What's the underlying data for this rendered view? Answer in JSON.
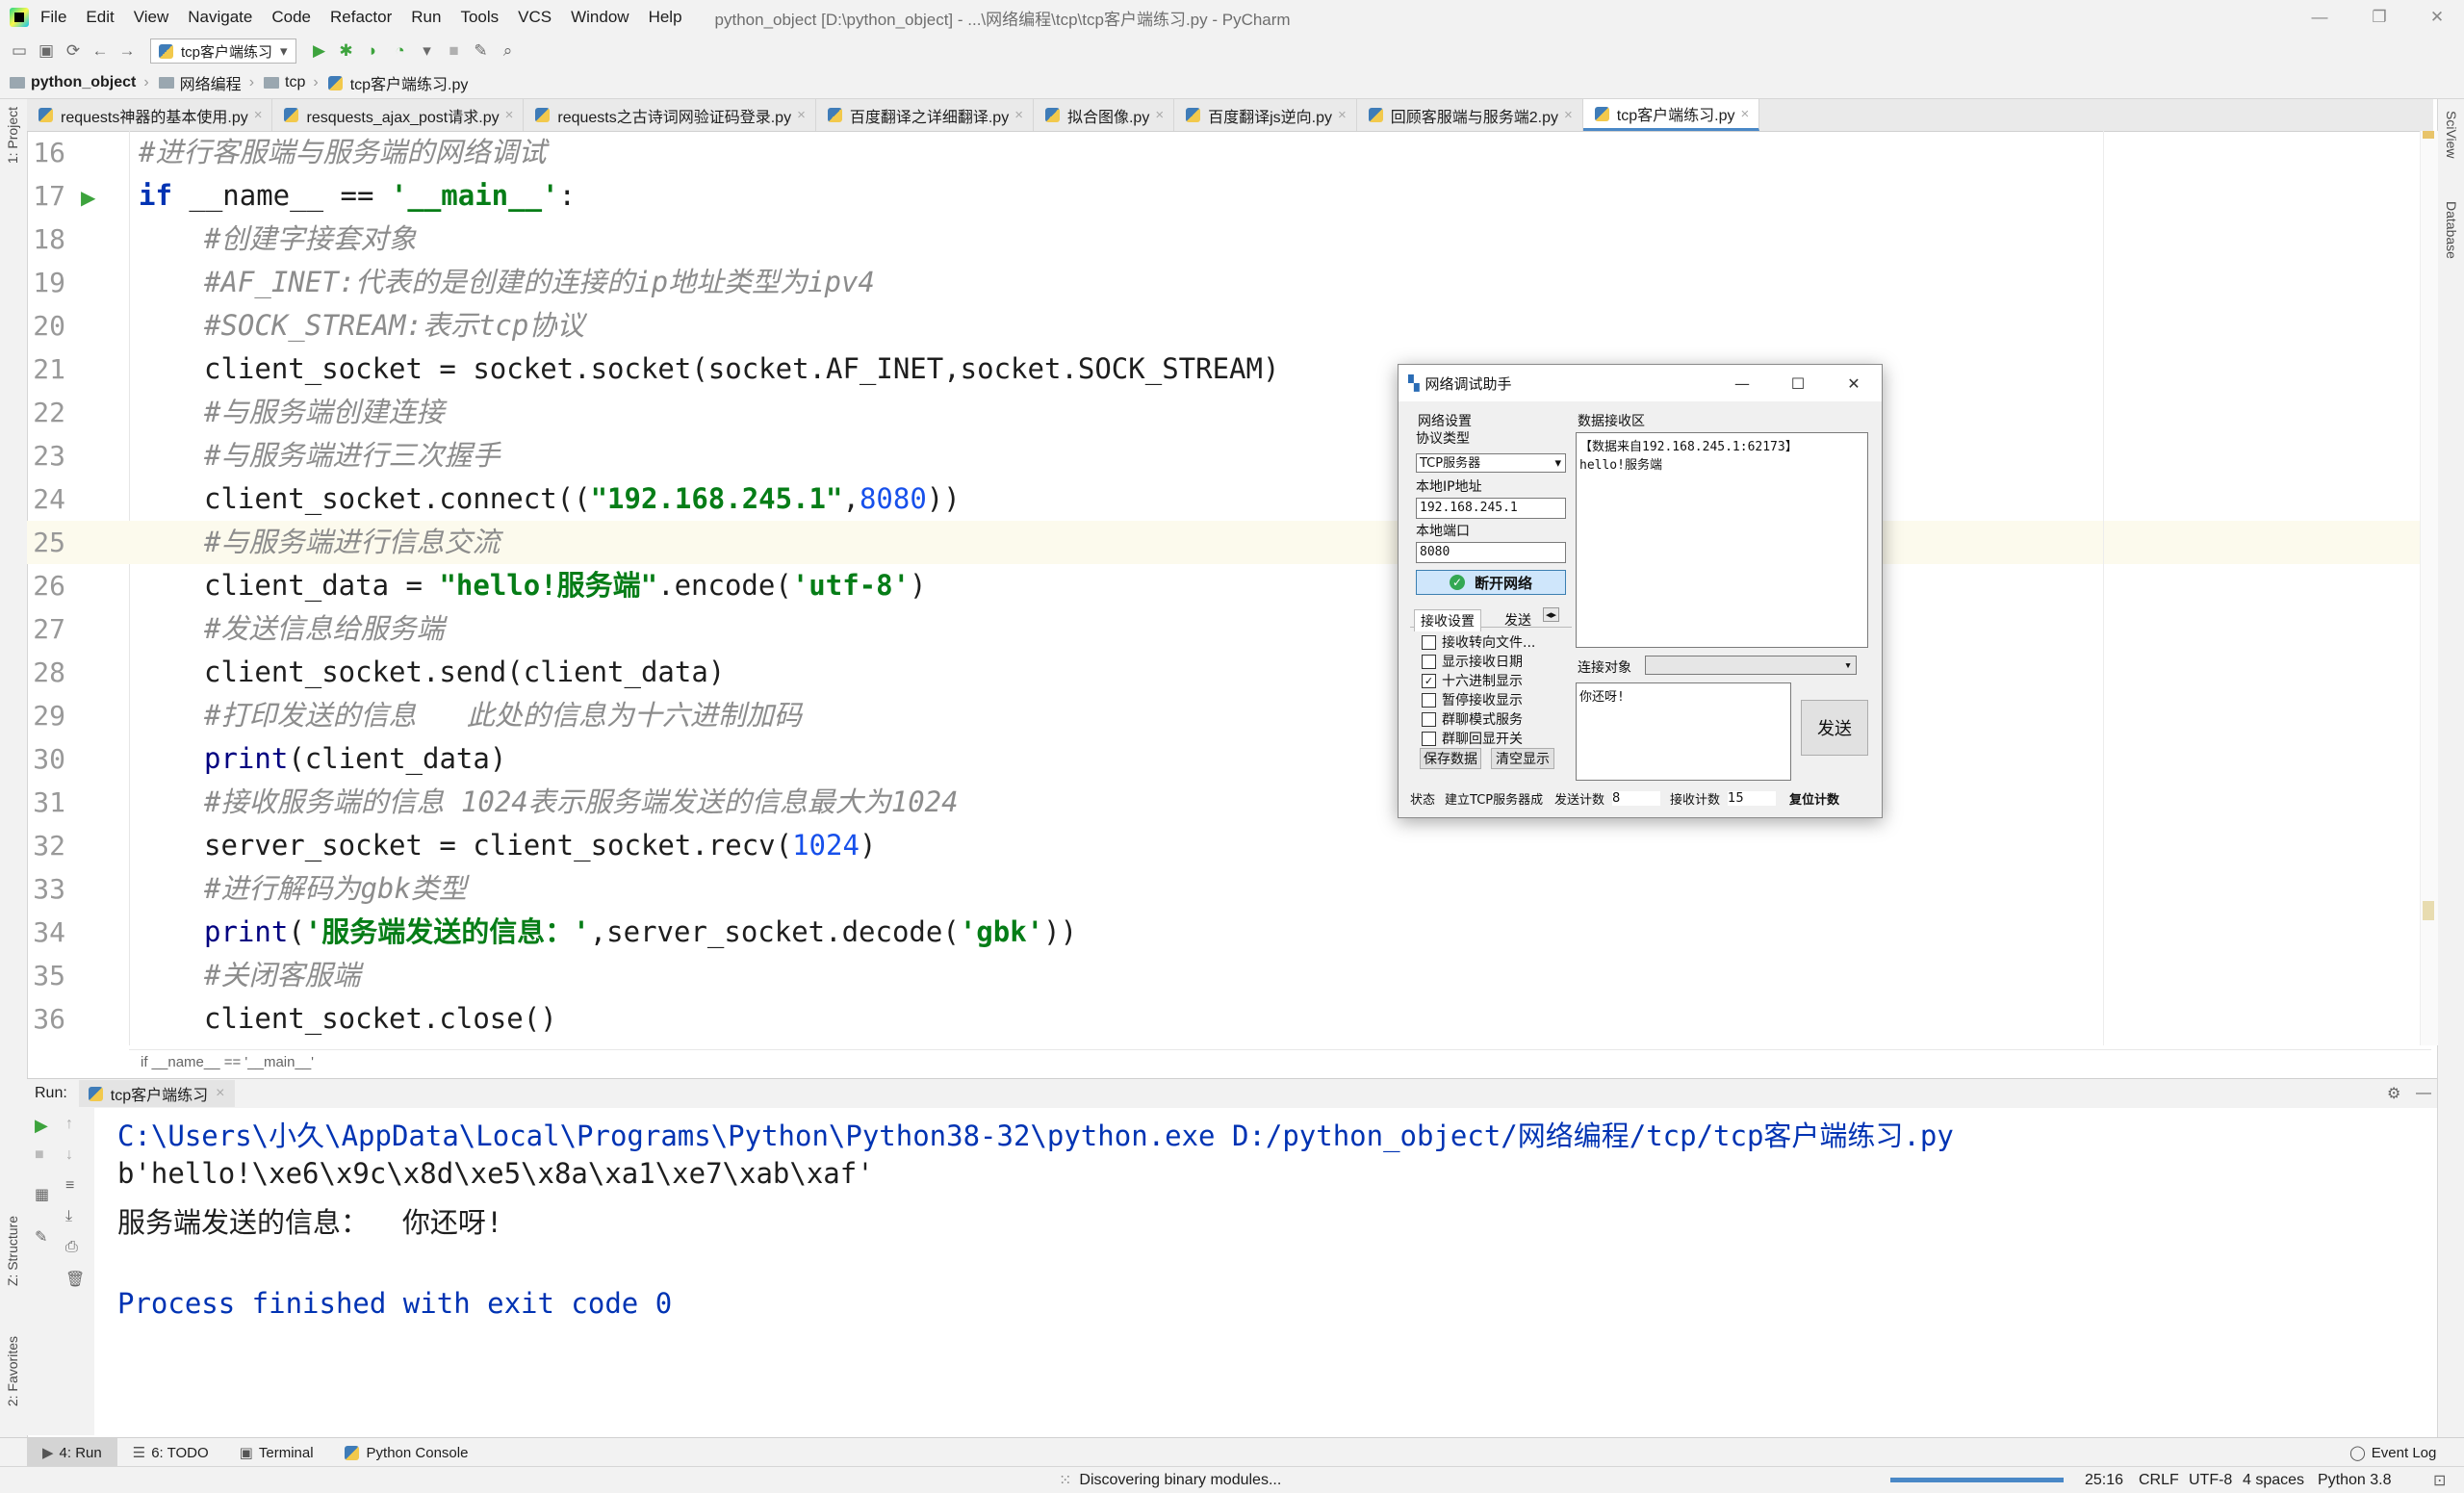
{
  "menubar": {
    "items": [
      "File",
      "Edit",
      "View",
      "Navigate",
      "Code",
      "Refactor",
      "Run",
      "Tools",
      "VCS",
      "Window",
      "Help"
    ],
    "title": "python_object [D:\\python_object] - ...\\网络编程\\tcp\\tcp客户端练习.py - PyCharm"
  },
  "toolbar": {
    "run_config": "tcp客户端练习"
  },
  "navbar": {
    "crumbs": [
      "python_object",
      "网络编程",
      "tcp",
      "tcp客户端练习.py"
    ]
  },
  "tabs": [
    "requests神器的基本使用.py",
    "resquests_ajax_post请求.py",
    "requests之古诗词网验证码登录.py",
    "百度翻译之详细翻译.py",
    "拟合图像.py",
    "百度翻译js逆向.py",
    "回顾客服端与服务端2.py",
    "tcp客户端练习.py"
  ],
  "sidebars": {
    "left_top": "1: Project",
    "left_structure": "Z: Structure",
    "left_favorites": "2: Favorites",
    "right_sciview": "SciView",
    "right_database": "Database"
  },
  "code": {
    "line_numbers": [
      "16",
      "17",
      "18",
      "19",
      "20",
      "21",
      "22",
      "23",
      "24",
      "25",
      "26",
      "27",
      "28",
      "29",
      "30",
      "31",
      "32",
      "33",
      "34",
      "35",
      "36"
    ],
    "l16": "#进行客服端与服务端的网络调试",
    "l17_kw": "if",
    "l17_a": " __name__ == ",
    "l17_s": "'__main__'",
    "l17_b": ":",
    "l18": "#创建字接套对象",
    "l19": "#AF_INET:代表的是创建的连接的ip地址类型为ipv4",
    "l20": "#SOCK_STREAM:表示tcp协议",
    "l21": "client_socket = socket.socket(socket.AF_INET,socket.SOCK_STREAM)",
    "l22": "#与服务端创建连接",
    "l23": "#与服务端进行三次握手",
    "l24_a": "client_socket.connect((",
    "l24_s": "\"192.168.245.1\"",
    "l24_b": ",",
    "l24_n": "8080",
    "l24_c": "))",
    "l25": "#与服务端进行信息交流",
    "l26_a": "client_data = ",
    "l26_s": "\"hello!服务端\"",
    "l26_b": ".encode(",
    "l26_s2": "'utf-8'",
    "l26_c": ")",
    "l27": "#发送信息给服务端",
    "l28": "client_socket.send(client_data)",
    "l29": "#打印发送的信息   此处的信息为十六进制加码",
    "l30_f": "print",
    "l30_a": "(client_data)",
    "l31": "#接收服务端的信息 1024表示服务端发送的信息最大为1024",
    "l32_a": "server_socket = client_socket.recv(",
    "l32_n": "1024",
    "l32_b": ")",
    "l33": "#进行解码为gbk类型",
    "l34_f": "print",
    "l34_a": "(",
    "l34_s": "'服务端发送的信息：'",
    "l34_b": ",server_socket.decode(",
    "l34_s2": "'gbk'",
    "l34_c": "))",
    "l35": "#关闭客服端",
    "l36": "client_socket.close()"
  },
  "editor_breadcrumb": "if __name__ == '__main__'",
  "run": {
    "label": "Run:",
    "tab": "tcp客户端练习",
    "output": [
      "C:\\Users\\小久\\AppData\\Local\\Programs\\Python\\Python38-32\\python.exe D:/python_object/网络编程/tcp/tcp客户端练习.py",
      "b'hello!\\xe6\\x9c\\x8d\\xe5\\x8a\\xa1\\xe7\\xab\\xaf'",
      "服务端发送的信息：  你还呀!",
      "",
      "Process finished with exit code 0"
    ]
  },
  "bottom_tools": [
    "4: Run",
    "6: TODO",
    "Terminal",
    "Python Console"
  ],
  "event_log": "Event Log",
  "status": {
    "message": "Discovering binary modules...",
    "position": "25:16",
    "line_sep": "CRLF",
    "encoding": "UTF-8",
    "indent": "4 spaces",
    "interpreter": "Python 3.8"
  },
  "dialog": {
    "title": "网络调试助手",
    "net_settings": "网络设置",
    "protocol_label": "协议类型",
    "protocol_value": "TCP服务器",
    "ip_label": "本地IP地址",
    "ip_value": "192.168.245.1",
    "port_label": "本地端口",
    "port_value": "8080",
    "disconnect_button": "断开网络",
    "recv_settings_tab": "接收设置",
    "send_settings_tab": "发送",
    "options": [
      "接收转向文件...",
      "显示接收日期",
      "十六进制显示",
      "暂停接收显示",
      "群聊模式服务",
      "群聊回显开关"
    ],
    "options_checked": [
      false,
      false,
      true,
      false,
      false,
      false
    ],
    "save_button": "保存数据",
    "clear_button": "清空显示",
    "recv_area_label": "数据接收区",
    "recv_text_1": "【数据来自192.168.245.1:62173】",
    "recv_text_2": "hello!服务端",
    "target_label": "连接对象",
    "send_text": "你还呀!",
    "send_button": "发送",
    "status_label": "状态",
    "status_value": "建立TCP服务器成",
    "send_count_label": "发送计数",
    "send_count": "8",
    "recv_count_label": "接收计数",
    "recv_count": "15",
    "reset_button": "复位计数"
  },
  "colors": {
    "accent": "#4a88c7",
    "keyword": "#0033b3",
    "string": "#067d17",
    "number": "#1750eb",
    "comment": "#8c8c8c",
    "current_line": "#fcfaed"
  }
}
